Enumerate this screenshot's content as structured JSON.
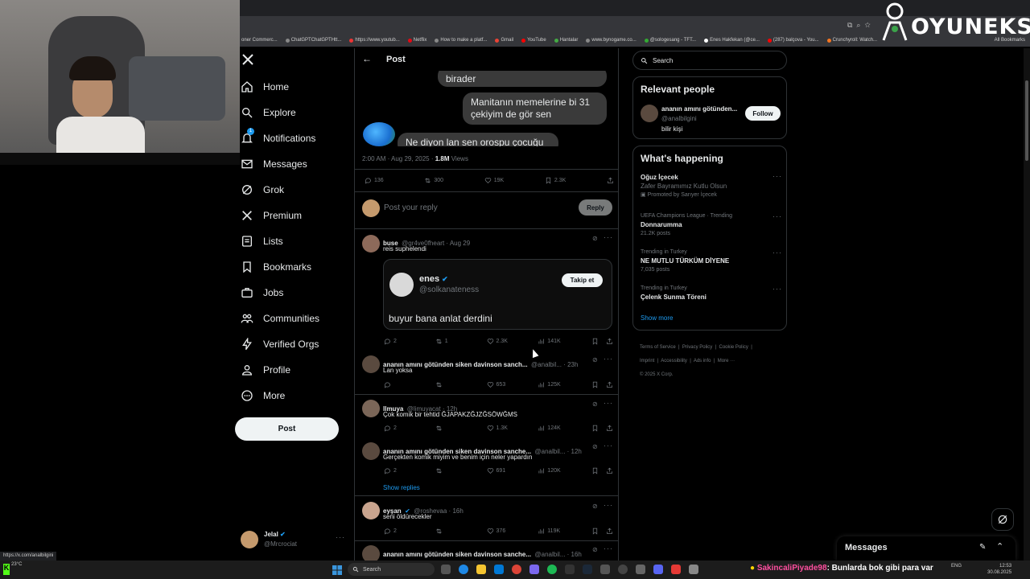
{
  "browser": {
    "bookmarks": [
      "oner Commerc...",
      "ChatGPTChatGPTHtt...",
      "https://www.youtub...",
      "Netflix",
      "How to make a platf...",
      "Gmail",
      "YouTube",
      "Hantalar",
      "www.bynogame.co...",
      "@sologesang - TFT...",
      "Enes Hakfekan (@ce...",
      "(287) balçova - You...",
      "Crunchyroll: Watch...",
      "All Bookmarks"
    ],
    "status_url": "https://x.com/analbilgini"
  },
  "overlay": {
    "brand": "OYUNEKS"
  },
  "sidebar": {
    "items": [
      {
        "label": "Home",
        "icon": "home-icon"
      },
      {
        "label": "Explore",
        "icon": "search-icon"
      },
      {
        "label": "Notifications",
        "icon": "bell-icon",
        "badge": "1"
      },
      {
        "label": "Messages",
        "icon": "envelope-icon"
      },
      {
        "label": "Grok",
        "icon": "grok-icon"
      },
      {
        "label": "Premium",
        "icon": "x-logo-icon"
      },
      {
        "label": "Lists",
        "icon": "list-icon"
      },
      {
        "label": "Bookmarks",
        "icon": "bookmark-icon"
      },
      {
        "label": "Jobs",
        "icon": "briefcase-icon"
      },
      {
        "label": "Communities",
        "icon": "people-icon"
      },
      {
        "label": "Verified Orgs",
        "icon": "lightning-icon"
      },
      {
        "label": "Profile",
        "icon": "person-icon"
      },
      {
        "label": "More",
        "icon": "more-circle-icon"
      }
    ],
    "post_button": "Post",
    "account": {
      "name": "Jelal",
      "handle": "@Mrcrociat"
    }
  },
  "main": {
    "header_title": "Post",
    "bubbles": [
      "birader",
      "Manitanın memelerine bi 31\nçekiyim de gör sen",
      "Ne diyon lan sen orospu çocuğu"
    ],
    "post_meta": {
      "time": "2:00 AM · Aug 29, 2025 · ",
      "views": "1.8M",
      "views_label": " Views"
    },
    "post_actions": {
      "replies": "136",
      "reposts": "300",
      "likes": "19K",
      "bookmarks": "2.3K"
    },
    "reply_box": {
      "placeholder": "Post your reply",
      "button": "Reply"
    },
    "replies": [
      {
        "name": "buse",
        "handle": "@gr4ve0fheart · Aug 29",
        "text": "reis suphelendi",
        "replies": "2",
        "reposts": "1",
        "likes": "2.3K",
        "views": "141K",
        "quote": {
          "name": "enes",
          "handle": "@solkanateness",
          "follow": "Takip et",
          "text": "buyur bana anlat derdini"
        }
      },
      {
        "name": "ananın amını götünden siken davinson sanch...",
        "handle": "@analbil... · 23h",
        "text": "Lan yoksa",
        "replies": "",
        "reposts": "",
        "likes": "653",
        "views": "125K"
      },
      {
        "name": "llmuya",
        "handle": "@limuyacat · 12h",
        "text": "Çok komik bir tehtid ĞJAPAKZĞJZĞSÖWĞMS",
        "replies": "2",
        "reposts": "",
        "likes": "1.3K",
        "views": "124K"
      },
      {
        "name": "ananın amını götünden siken davinson sanche...",
        "handle": "@analbil... · 12h",
        "text": "Gerçekten komik miyim ve benim için neler yapardın",
        "replies": "2",
        "reposts": "",
        "likes": "691",
        "views": "120K"
      },
      {
        "name": "eyşan",
        "handle": "@roshevaa · 16h",
        "text": "seni öldürecekler",
        "replies": "2",
        "reposts": "",
        "likes": "376",
        "views": "119K"
      },
      {
        "name": "ananın amını götünden siken davinson sanche...",
        "handle": "@analbil... · 16h",
        "text": "",
        "replies": "",
        "reposts": "",
        "likes": "",
        "views": ""
      }
    ],
    "show_replies": "Show replies"
  },
  "right": {
    "search_placeholder": "Search",
    "relevant": {
      "title": "Relevant people",
      "name": "ananın amını götünden...",
      "handle": "@analbilgini",
      "bio": "bilir kişi",
      "follow": "Follow"
    },
    "happening": {
      "title": "What's happening",
      "trends": [
        {
          "meta": "",
          "name": "Oğuz İçecek",
          "sub": "Zafer Bayramımız Kutlu Olsun",
          "extra": "Promoted by Sarıyer İçecek"
        },
        {
          "meta": "UEFA Champions League · Trending",
          "name": "Donnarumma",
          "sub": "",
          "extra": "21.2K posts"
        },
        {
          "meta": "Trending in Turkey",
          "name": "NE MUTLU TÜRKÜM DİYENE",
          "sub": "",
          "extra": "7,035 posts"
        },
        {
          "meta": "Trending in Turkey",
          "name": "Çelenk Sunma Töreni",
          "sub": "",
          "extra": ""
        }
      ],
      "show_more": "Show more"
    },
    "footer": [
      "Terms of Service",
      "Privacy Policy",
      "Cookie Policy",
      "Imprint",
      "Accessibility",
      "Ads info",
      "More ···",
      "© 2025 X Corp."
    ],
    "messages_label": "Messages"
  },
  "taskbar": {
    "search": "Search",
    "chat": {
      "user": "SakincaliPiyade98",
      "msg": ": Bunlarda bok gibi para var"
    },
    "weather": "23°C",
    "lang": "ENG",
    "time": "12:53",
    "date": "30.08.2025"
  },
  "colors": {
    "accent": "#1d9bf0",
    "bg": "#000000",
    "border": "#2f3336"
  }
}
